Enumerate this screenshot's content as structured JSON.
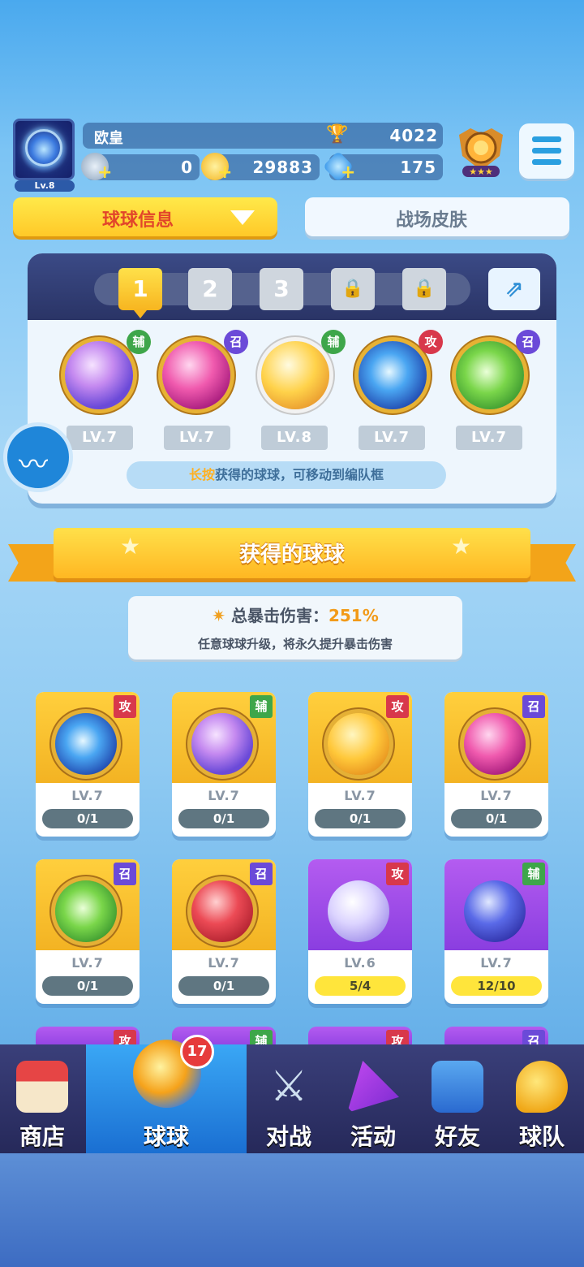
{
  "player": {
    "name": "欧皇",
    "level": "Lv.8",
    "trophies": "4022",
    "silver": "0",
    "gold": "29883",
    "gems": "175"
  },
  "tabs": {
    "ball_info": "球球信息",
    "skins": "战场皮肤"
  },
  "lineup": {
    "slots": [
      "1",
      "2",
      "3"
    ],
    "balls": [
      {
        "tag": "辅",
        "level": "LV.7"
      },
      {
        "tag": "召",
        "level": "LV.7"
      },
      {
        "tag": "辅",
        "level": "LV.8"
      },
      {
        "tag": "攻",
        "level": "LV.7"
      },
      {
        "tag": "召",
        "level": "LV.7"
      }
    ],
    "hint_highlight": "长按",
    "hint_text": "获得的球球，可移动到编队框"
  },
  "obtained": {
    "title": "获得的球球",
    "crit_label": "总暴击伤害：",
    "crit_value": "251%",
    "crit_desc": "任意球球升级，将永久提升暴击伤害"
  },
  "cards": [
    {
      "tag": "攻",
      "level": "LV.7",
      "progress": "0/1"
    },
    {
      "tag": "辅",
      "level": "LV.7",
      "progress": "0/1"
    },
    {
      "tag": "攻",
      "level": "LV.7",
      "progress": "0/1"
    },
    {
      "tag": "召",
      "level": "LV.7",
      "progress": "0/1"
    },
    {
      "tag": "召",
      "level": "LV.7",
      "progress": "0/1"
    },
    {
      "tag": "召",
      "level": "LV.7",
      "progress": "0/1"
    },
    {
      "tag": "攻",
      "level": "LV.6",
      "progress": "5/4"
    },
    {
      "tag": "辅",
      "level": "LV.7",
      "progress": "12/10"
    }
  ],
  "partial_tags": [
    "攻",
    "辅",
    "攻",
    "召"
  ],
  "nav": {
    "shop": "商店",
    "balls": "球球",
    "battle": "对战",
    "events": "活动",
    "friends": "好友",
    "team": "球队",
    "balls_badge": "17"
  },
  "colors": {
    "tab_active": "#ffd93a",
    "accent_red": "#e2462a",
    "nav_bg": "#2e3266",
    "nav_active": "#2a8be6"
  }
}
